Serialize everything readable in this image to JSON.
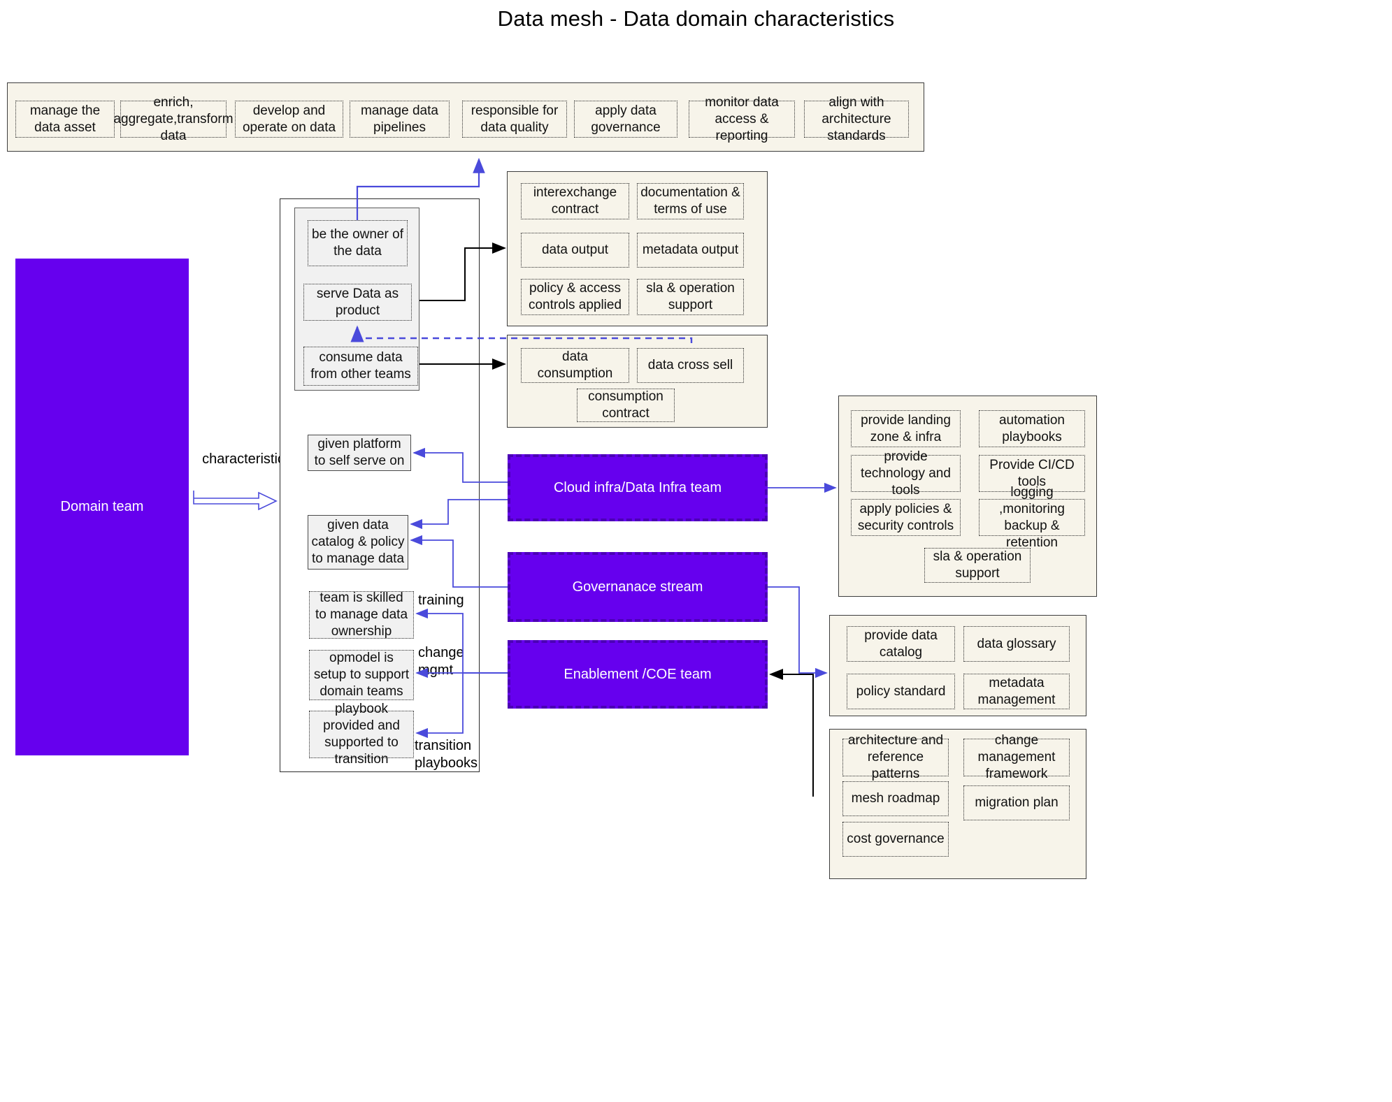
{
  "title": "Data mesh - Data domain characteristics",
  "colors": {
    "purple": "#6600ee",
    "purple_border": "#4b00b5",
    "panel_bg": "#f7f4ea",
    "grey_bg": "#f1f1f1",
    "arrow_blue": "#4a4adb",
    "arrow_black": "#000000"
  },
  "domain_team": {
    "label": "Domain team"
  },
  "characteristics_arrow": {
    "label": "characteristics"
  },
  "responsibilities_panel": {
    "items": [
      "manage the data asset",
      "enrich, aggregate,transform data",
      "develop and operate on data",
      "manage data pipelines",
      "responsible for data quality",
      "apply data governance",
      "monitor data access & reporting",
      "align with architecture standards"
    ]
  },
  "domain_column": {
    "ownership_group": [
      "be the owner of the data",
      "serve Data as product",
      "consume data from other teams"
    ],
    "platform_items": [
      "given platform to self serve on",
      "given data catalog & policy to manage data"
    ],
    "enablement_items": [
      "team is skilled to manage data ownership",
      "opmodel is setup to support domain teams",
      "playbook provided and supported to transition"
    ]
  },
  "data_product_panel": {
    "items": [
      "interexchange contract",
      "documentation & terms of use",
      "data output",
      "metadata output",
      "policy & access controls applied",
      "sla & operation support"
    ]
  },
  "consumption_panel": {
    "items": [
      "data consumption",
      "data cross sell",
      "consumption contract"
    ]
  },
  "teams": {
    "cloud_infra": "Cloud infra/Data Infra team",
    "governance": "Governanace stream",
    "enablement": "Enablement /COE team"
  },
  "cloud_infra_panel": {
    "items": [
      "provide landing zone & infra",
      "automation playbooks",
      "provide technology and tools",
      "Provide CI/CD tools",
      "apply policies & security controls",
      "logging ,monitoring backup & retention",
      "sla & operation support"
    ]
  },
  "governance_panel": {
    "items": [
      "provide data catalog",
      "data glossary",
      "policy standard",
      "metadata management"
    ]
  },
  "enablement_panel": {
    "items": [
      "architecture and reference patterns",
      "change management framework",
      "mesh roadmap",
      "migration plan",
      "cost governance"
    ]
  },
  "edge_labels": {
    "training": "training",
    "change_mgmt": "change\nmgmt",
    "transition_playbooks": "transition\nplaybooks"
  }
}
